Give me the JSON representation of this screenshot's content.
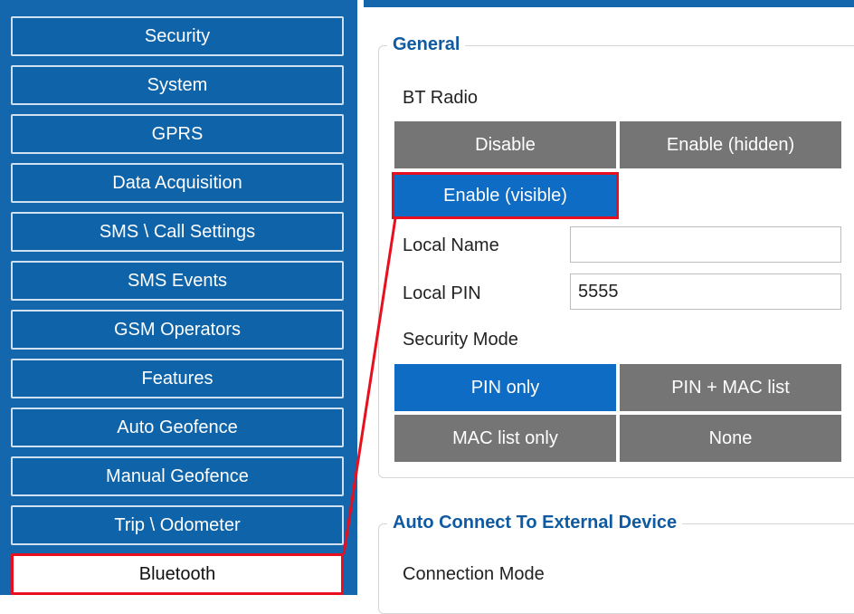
{
  "sidebar": {
    "items": [
      {
        "label": "Security"
      },
      {
        "label": "System"
      },
      {
        "label": "GPRS"
      },
      {
        "label": "Data Acquisition"
      },
      {
        "label": "SMS \\ Call Settings"
      },
      {
        "label": "SMS Events"
      },
      {
        "label": "GSM Operators"
      },
      {
        "label": "Features"
      },
      {
        "label": "Auto Geofence"
      },
      {
        "label": "Manual Geofence"
      },
      {
        "label": "Trip \\ Odometer"
      },
      {
        "label": "Bluetooth",
        "active": true
      }
    ]
  },
  "general": {
    "title": "General",
    "bt_radio": {
      "label": "BT Radio",
      "options": [
        "Disable",
        "Enable (hidden)",
        "Enable (visible)"
      ],
      "selected": "Enable (visible)"
    },
    "local_name": {
      "label": "Local Name",
      "value": ""
    },
    "local_pin": {
      "label": "Local PIN",
      "value": "5555"
    },
    "security_mode": {
      "label": "Security Mode",
      "options": [
        "PIN only",
        "PIN + MAC list",
        "MAC list only",
        "None"
      ],
      "selected": "PIN only"
    }
  },
  "auto_connect": {
    "title": "Auto Connect To External Device",
    "connection_mode": {
      "label": "Connection Mode"
    }
  },
  "colors": {
    "sidebar_bg": "#1466ad",
    "selected_option": "#0e6cc4",
    "unselected_option": "#757575",
    "highlight": "#e8101e",
    "group_title": "#0f5aa0"
  }
}
